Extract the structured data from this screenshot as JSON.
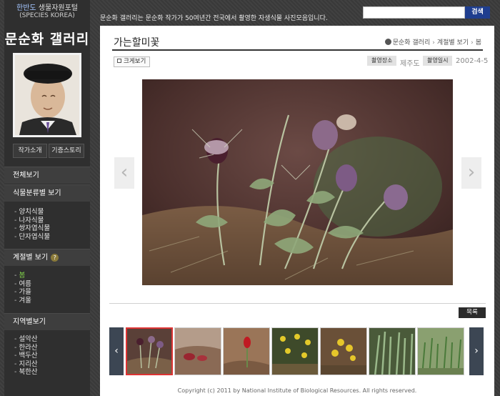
{
  "sidebar": {
    "portal_accent": "한반도",
    "portal_title": "생물자원포털",
    "portal_subtitle": "(SPECIES KOREA)",
    "logo": "문순화 갤러리",
    "buttons": {
      "author": "작가소개",
      "memorial": "기증스토리"
    },
    "menu_all": "전체보기",
    "menu_classification": "식물분류별 보기",
    "classification_items": [
      "양치식물",
      "나자식물",
      "쌍자엽식물",
      "단자엽식물"
    ],
    "menu_season": "계절별 보기",
    "season_items": [
      "봄",
      "여름",
      "가을",
      "겨울"
    ],
    "season_active_index": 0,
    "menu_region": "지역별보기",
    "region_items": [
      "설악산",
      "한라산",
      "백두산",
      "지리산",
      "북한산"
    ]
  },
  "top": {
    "description": "문순화 갤러리는 문순화 작가가 50여년간 전국에서 촬영한 자생식물 사진모음입니다.",
    "search_placeholder": "",
    "search_button": "검색"
  },
  "main": {
    "title": "가는할미꽃",
    "breadcrumb": [
      "문순화 갤러리",
      "계절별 보기",
      "봄"
    ],
    "enlarge_label": "크게보기",
    "place_tag": "촬영장소",
    "place_value": "제주도",
    "date_tag": "촬영일시",
    "date_value": "2002-4-5",
    "prev_arrow": "‹",
    "next_arrow": "›",
    "list_button": "목록",
    "thumb_prev": "‹",
    "thumb_next": "›",
    "copyright": "Copyright (c) 2011 by National Institute of Biological Resources. All rights reserved."
  },
  "colors": {
    "background": "#3b3b3b",
    "sidebar": "#2f2f2f",
    "search_button": "#1f3e8f",
    "active_menu": "#7fd04a",
    "selected_thumb_border": "#dd3333"
  },
  "icons": {
    "help": "question-icon",
    "home": "home-icon",
    "enlarge": "magnify-icon"
  }
}
